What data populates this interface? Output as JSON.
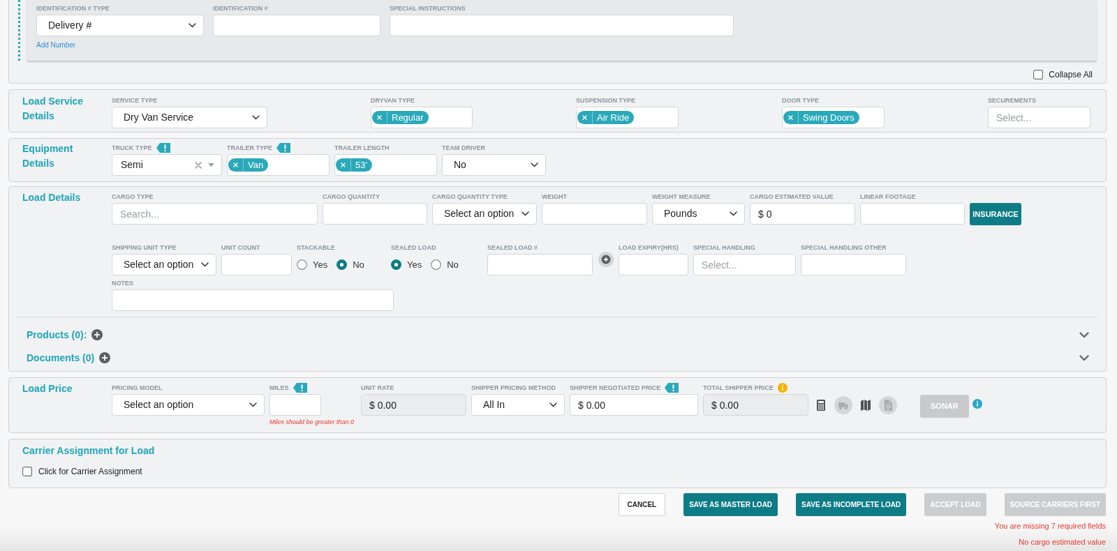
{
  "identification": {
    "fields": [
      {
        "kind": "select",
        "label": "IDENTIFICATION # TYPE",
        "value": "Delivery #"
      },
      {
        "kind": "input",
        "label": "IDENTIFICATION #"
      },
      {
        "kind": "input",
        "label": "SPECIAL INSTRUCTIONS"
      }
    ],
    "link": "Add Number"
  },
  "collapse_all": {
    "label": "Collapse All",
    "checked": false
  },
  "load_service": {
    "title": "Load Service Details",
    "fields": [
      {
        "kind": "select",
        "label": "SERVICE TYPE",
        "value": "Dry Van Service"
      },
      {
        "kind": "tags",
        "label": "DRYVAN TYPE",
        "tags": [
          "Regular"
        ]
      },
      {
        "kind": "tags",
        "label": "SUSPENSION TYPE",
        "tags": [
          "Air Ride"
        ]
      },
      {
        "kind": "tags",
        "label": "DOOR TYPE",
        "tags": [
          "Swing Doors"
        ]
      },
      {
        "kind": "multiselect",
        "label": "SECUREMENTS",
        "placeholder": "Select..."
      }
    ]
  },
  "equipment": {
    "title": "Equipment Details",
    "fields": [
      {
        "kind": "combo",
        "label": "TRUCK TYPE",
        "flagged": true,
        "value": "Semi"
      },
      {
        "kind": "tags",
        "label": "TRAILER TYPE",
        "flagged": true,
        "tags": [
          "Van"
        ]
      },
      {
        "kind": "tags",
        "label": "TRAILER LENGTH",
        "flagged": false,
        "tags": [
          "53'"
        ]
      },
      {
        "kind": "select",
        "label": "TEAM DRIVER",
        "flagged": false,
        "value": "No"
      }
    ]
  },
  "load_details": {
    "title": "Load Details",
    "lines": [
      {
        "fields": [
          {
            "kind": "input",
            "label": "CARGO TYPE",
            "placeholder": "Search..."
          },
          {
            "kind": "input",
            "label": "CARGO QUANTITY"
          },
          {
            "kind": "select",
            "label": "CARGO QUANTITY TYPE",
            "value": "Select an option"
          },
          {
            "kind": "input",
            "label": "WEIGHT"
          },
          {
            "kind": "select",
            "label": "WEIGHT MEASURE",
            "value": "Pounds"
          },
          {
            "kind": "input",
            "label": "CARGO ESTIMATED VALUE",
            "value": "$ 0"
          },
          {
            "kind": "input",
            "label": "LINEAR FOOTAGE"
          },
          {
            "kind": "button",
            "label": "INSURANCE"
          }
        ]
      },
      {
        "fields": [
          {
            "kind": "select",
            "label": "SHIPPING UNIT TYPE",
            "value": "Select an option"
          },
          {
            "kind": "input",
            "label": "UNIT COUNT"
          },
          {
            "kind": "radio",
            "label": "STACKABLE",
            "options": [
              {
                "label": "Yes",
                "selected": false
              },
              {
                "label": "No",
                "selected": true
              }
            ]
          },
          {
            "kind": "radio",
            "label": "SEALED LOAD",
            "options": [
              {
                "label": "Yes",
                "selected": true
              },
              {
                "label": "No",
                "selected": false
              }
            ]
          },
          {
            "kind": "input",
            "label": "SEALED LOAD #",
            "add_button": true
          },
          {
            "kind": "input",
            "label": "LOAD EXPIRY(HRS)"
          },
          {
            "kind": "multiselect",
            "label": "SPECIAL HANDLING",
            "placeholder": "Select..."
          },
          {
            "kind": "input",
            "label": "SPECIAL HANDLING OTHER"
          }
        ]
      },
      {
        "fields": [
          {
            "kind": "input",
            "label": "NOTES"
          }
        ]
      }
    ],
    "expanders": [
      {
        "label": "Products (0):",
        "expanded": false
      },
      {
        "label": "Documents (0)",
        "expanded": false
      }
    ]
  },
  "load_price": {
    "title": "Load Price",
    "fields": [
      {
        "kind": "select",
        "label": "PRICING MODEL",
        "flagged": false,
        "value": "Select an option"
      },
      {
        "kind": "input",
        "label": "MILES",
        "flagged": true,
        "disabled": false,
        "error": "Miles should be greater than 0"
      },
      {
        "kind": "input",
        "label": "UNIT RATE",
        "flagged": false,
        "disabled": true,
        "value": "$ 0.00"
      },
      {
        "kind": "select",
        "label": "SHIPPER PRICING METHOD",
        "flagged": false,
        "value": "All In"
      },
      {
        "kind": "input",
        "label": "SHIPPER NEGOTIATED PRICE",
        "flagged": true,
        "disabled": false,
        "value": "$ 0.00"
      },
      {
        "kind": "input",
        "label": "TOTAL SHIPPER PRICE",
        "flagged": false,
        "info": true,
        "disabled": true,
        "value": "$ 0.00"
      }
    ],
    "tools": [
      {
        "kind": "calculator",
        "disabled": false
      },
      {
        "kind": "truck",
        "disabled": true
      },
      {
        "kind": "map",
        "disabled": false
      },
      {
        "kind": "document",
        "disabled": true
      }
    ],
    "sonar": {
      "label": "SONAR",
      "disabled": true,
      "info": true
    }
  },
  "carrier": {
    "title": "Carrier Assignment for Load",
    "checkbox": {
      "label": "Click for Carrier Assignment",
      "checked": false
    }
  },
  "actions": [
    {
      "label": "CANCEL",
      "kind": "secondary",
      "disabled": false
    },
    {
      "label": "SAVE AS MASTER LOAD",
      "kind": "primary",
      "disabled": false
    },
    {
      "label": "SAVE AS INCOMPLETE LOAD",
      "kind": "primary",
      "disabled": false
    },
    {
      "label": "ACCEPT LOAD",
      "kind": "primary",
      "disabled": true
    },
    {
      "label": "SOURCE CARRIERS FIRST",
      "kind": "primary",
      "disabled": true
    }
  ],
  "errors": [
    "You are missing 7 required fields",
    "No cargo estimated value"
  ]
}
